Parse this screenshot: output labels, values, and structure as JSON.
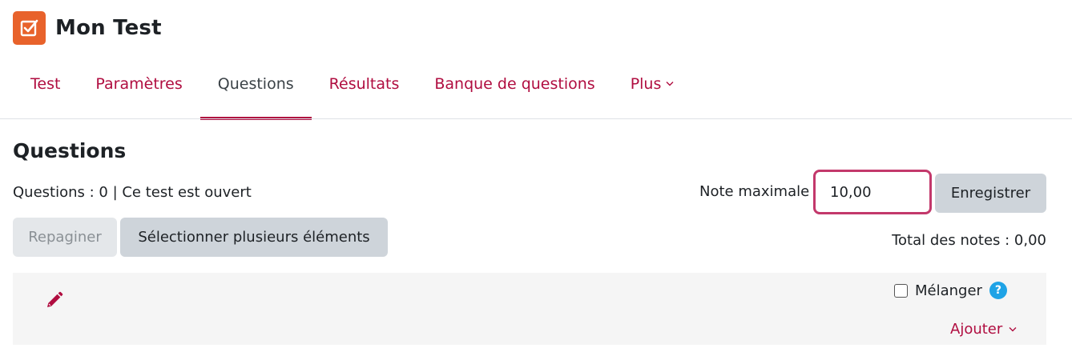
{
  "header": {
    "title": "Mon Test",
    "icon": "quiz-checkbox-icon",
    "icon_color": "#e8622b"
  },
  "tabs": [
    {
      "label": "Test",
      "active": false
    },
    {
      "label": "Paramètres",
      "active": false
    },
    {
      "label": "Questions",
      "active": true
    },
    {
      "label": "Résultats",
      "active": false
    },
    {
      "label": "Banque de questions",
      "active": false
    },
    {
      "label": "Plus",
      "active": false,
      "icon": "chevron-down-icon"
    }
  ],
  "main": {
    "heading": "Questions",
    "status": "Questions : 0 | Ce test est ouvert",
    "repaginate_label": "Repagine r",
    "select_multiple_label": "Sélectionner plusieurs éléments",
    "max_grade": {
      "label": "Note maximale",
      "value": "10,00",
      "save_label": "Enregistrer"
    },
    "total_grades": "Total des notes : 0,00",
    "section": {
      "edit_icon": "pencil-icon",
      "shuffle_label": "Mélanger",
      "shuffle_checked": false,
      "help_icon": "help-icon",
      "add_label": "Ajouter"
    }
  },
  "colors": {
    "accent": "#b00d40",
    "input_focus_border": "#c3386b",
    "help": "#1fa3e6"
  }
}
